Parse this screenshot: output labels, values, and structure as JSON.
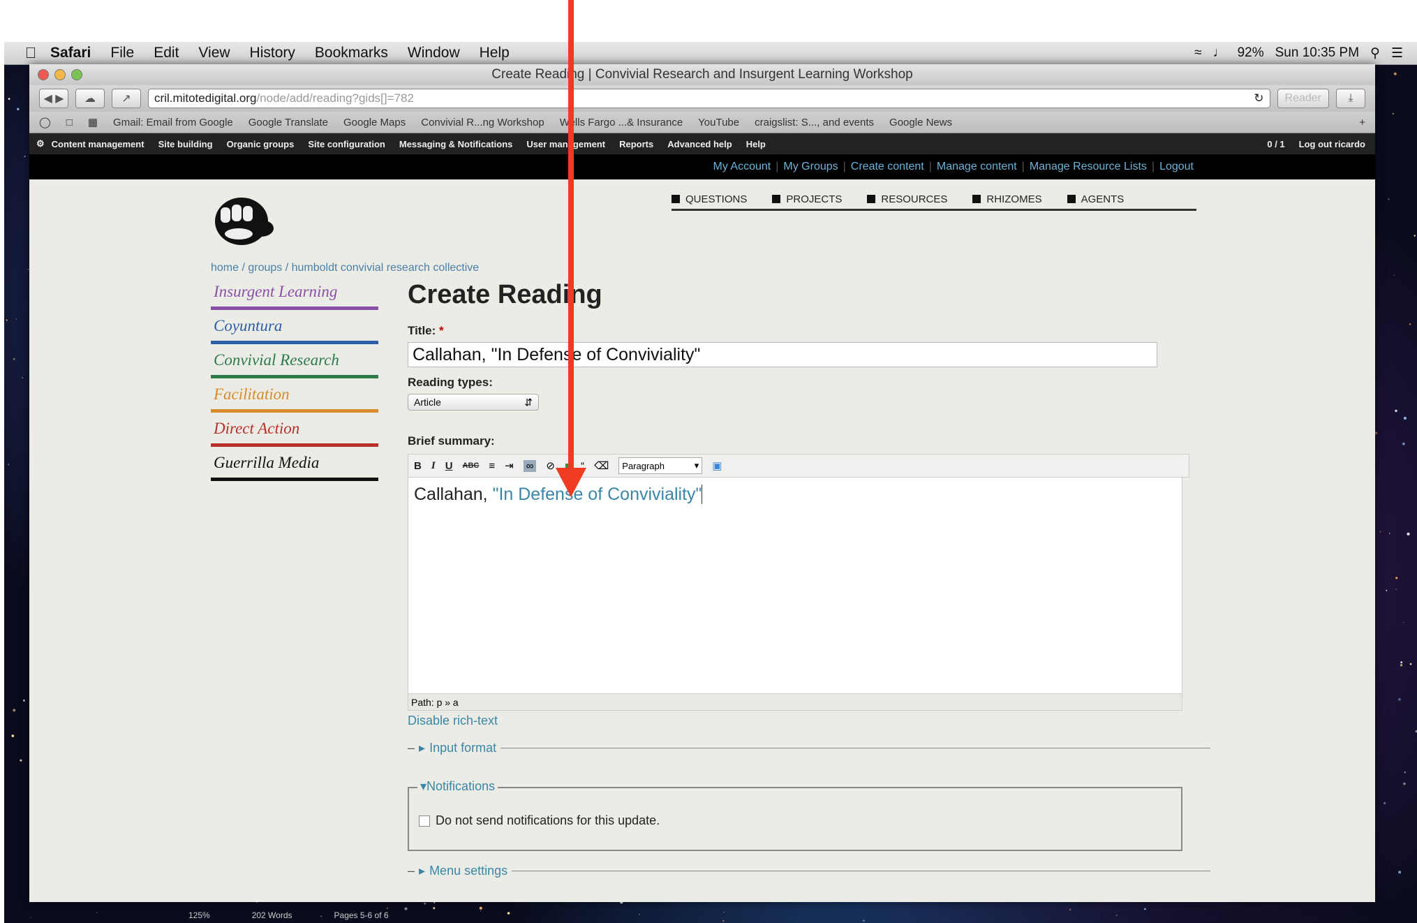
{
  "menubar": {
    "app": "Safari",
    "items": [
      "File",
      "Edit",
      "View",
      "History",
      "Bookmarks",
      "Window",
      "Help"
    ],
    "battery": "92%",
    "clock": "Sun 10:35 PM"
  },
  "window": {
    "title": "Create Reading | Convivial Research and Insurgent Learning Workshop"
  },
  "toolbar": {
    "url_host": "cril.mitotedigital.org",
    "url_path": "/node/add/reading?gids[]=782",
    "reader_label": "Reader"
  },
  "bookmarks": [
    "Gmail: Email from Google",
    "Google Translate",
    "Google Maps",
    "Convivial R...ng Workshop",
    "Wells Fargo ...& Insurance",
    "YouTube",
    "craigslist: S..., and events",
    "Google News"
  ],
  "adminbar": {
    "items": [
      "Content management",
      "Site building",
      "Organic groups",
      "Site configuration",
      "Messaging & Notifications",
      "User management",
      "Reports",
      "Advanced help",
      "Help"
    ],
    "counter": "0 / 1",
    "logout": "Log out ricardo"
  },
  "topnav": [
    "My Account",
    "My Groups",
    "Create content",
    "Manage content",
    "Manage Resource Lists",
    "Logout"
  ],
  "mainnav": [
    "QUESTIONS",
    "PROJECTS",
    "RESOURCES",
    "RHIZOMES",
    "AGENTS"
  ],
  "breadcrumb": "home / groups / humboldt convivial research collective",
  "sidebar": [
    {
      "label": "Insurgent Learning",
      "color": "#8a4fa8"
    },
    {
      "label": "Coyuntura",
      "color": "#2c5fa8"
    },
    {
      "label": "Convivial Research",
      "color": "#2c7a4a"
    },
    {
      "label": "Facilitation",
      "color": "#d98a2a"
    },
    {
      "label": "Direct Action",
      "color": "#b8302a"
    },
    {
      "label": "Guerrilla Media",
      "color": "#111111"
    }
  ],
  "form": {
    "page_title": "Create Reading",
    "title_label": "Title:",
    "title_required": "*",
    "title_value": "Callahan, \"In Defense of Conviviality\"",
    "reading_types_label": "Reading types:",
    "reading_type_value": "Article",
    "brief_summary_label": "Brief summary:",
    "editor_format": "Paragraph",
    "editor_text_plain": "Callahan, ",
    "editor_text_quote": "\"In Defense of Conviviality\"",
    "path": "Path: p » a",
    "disable_rich_text": "Disable rich-text",
    "input_format": "Input format",
    "notifications": "Notifications",
    "notif_checkbox_label": "Do not send notifications for this update.",
    "menu_settings": "Menu settings"
  },
  "statusbar": {
    "zoom": "125%",
    "words": "202 Words",
    "pages": "Pages 5-6 of 6"
  },
  "annotation_color": "#f03a22"
}
